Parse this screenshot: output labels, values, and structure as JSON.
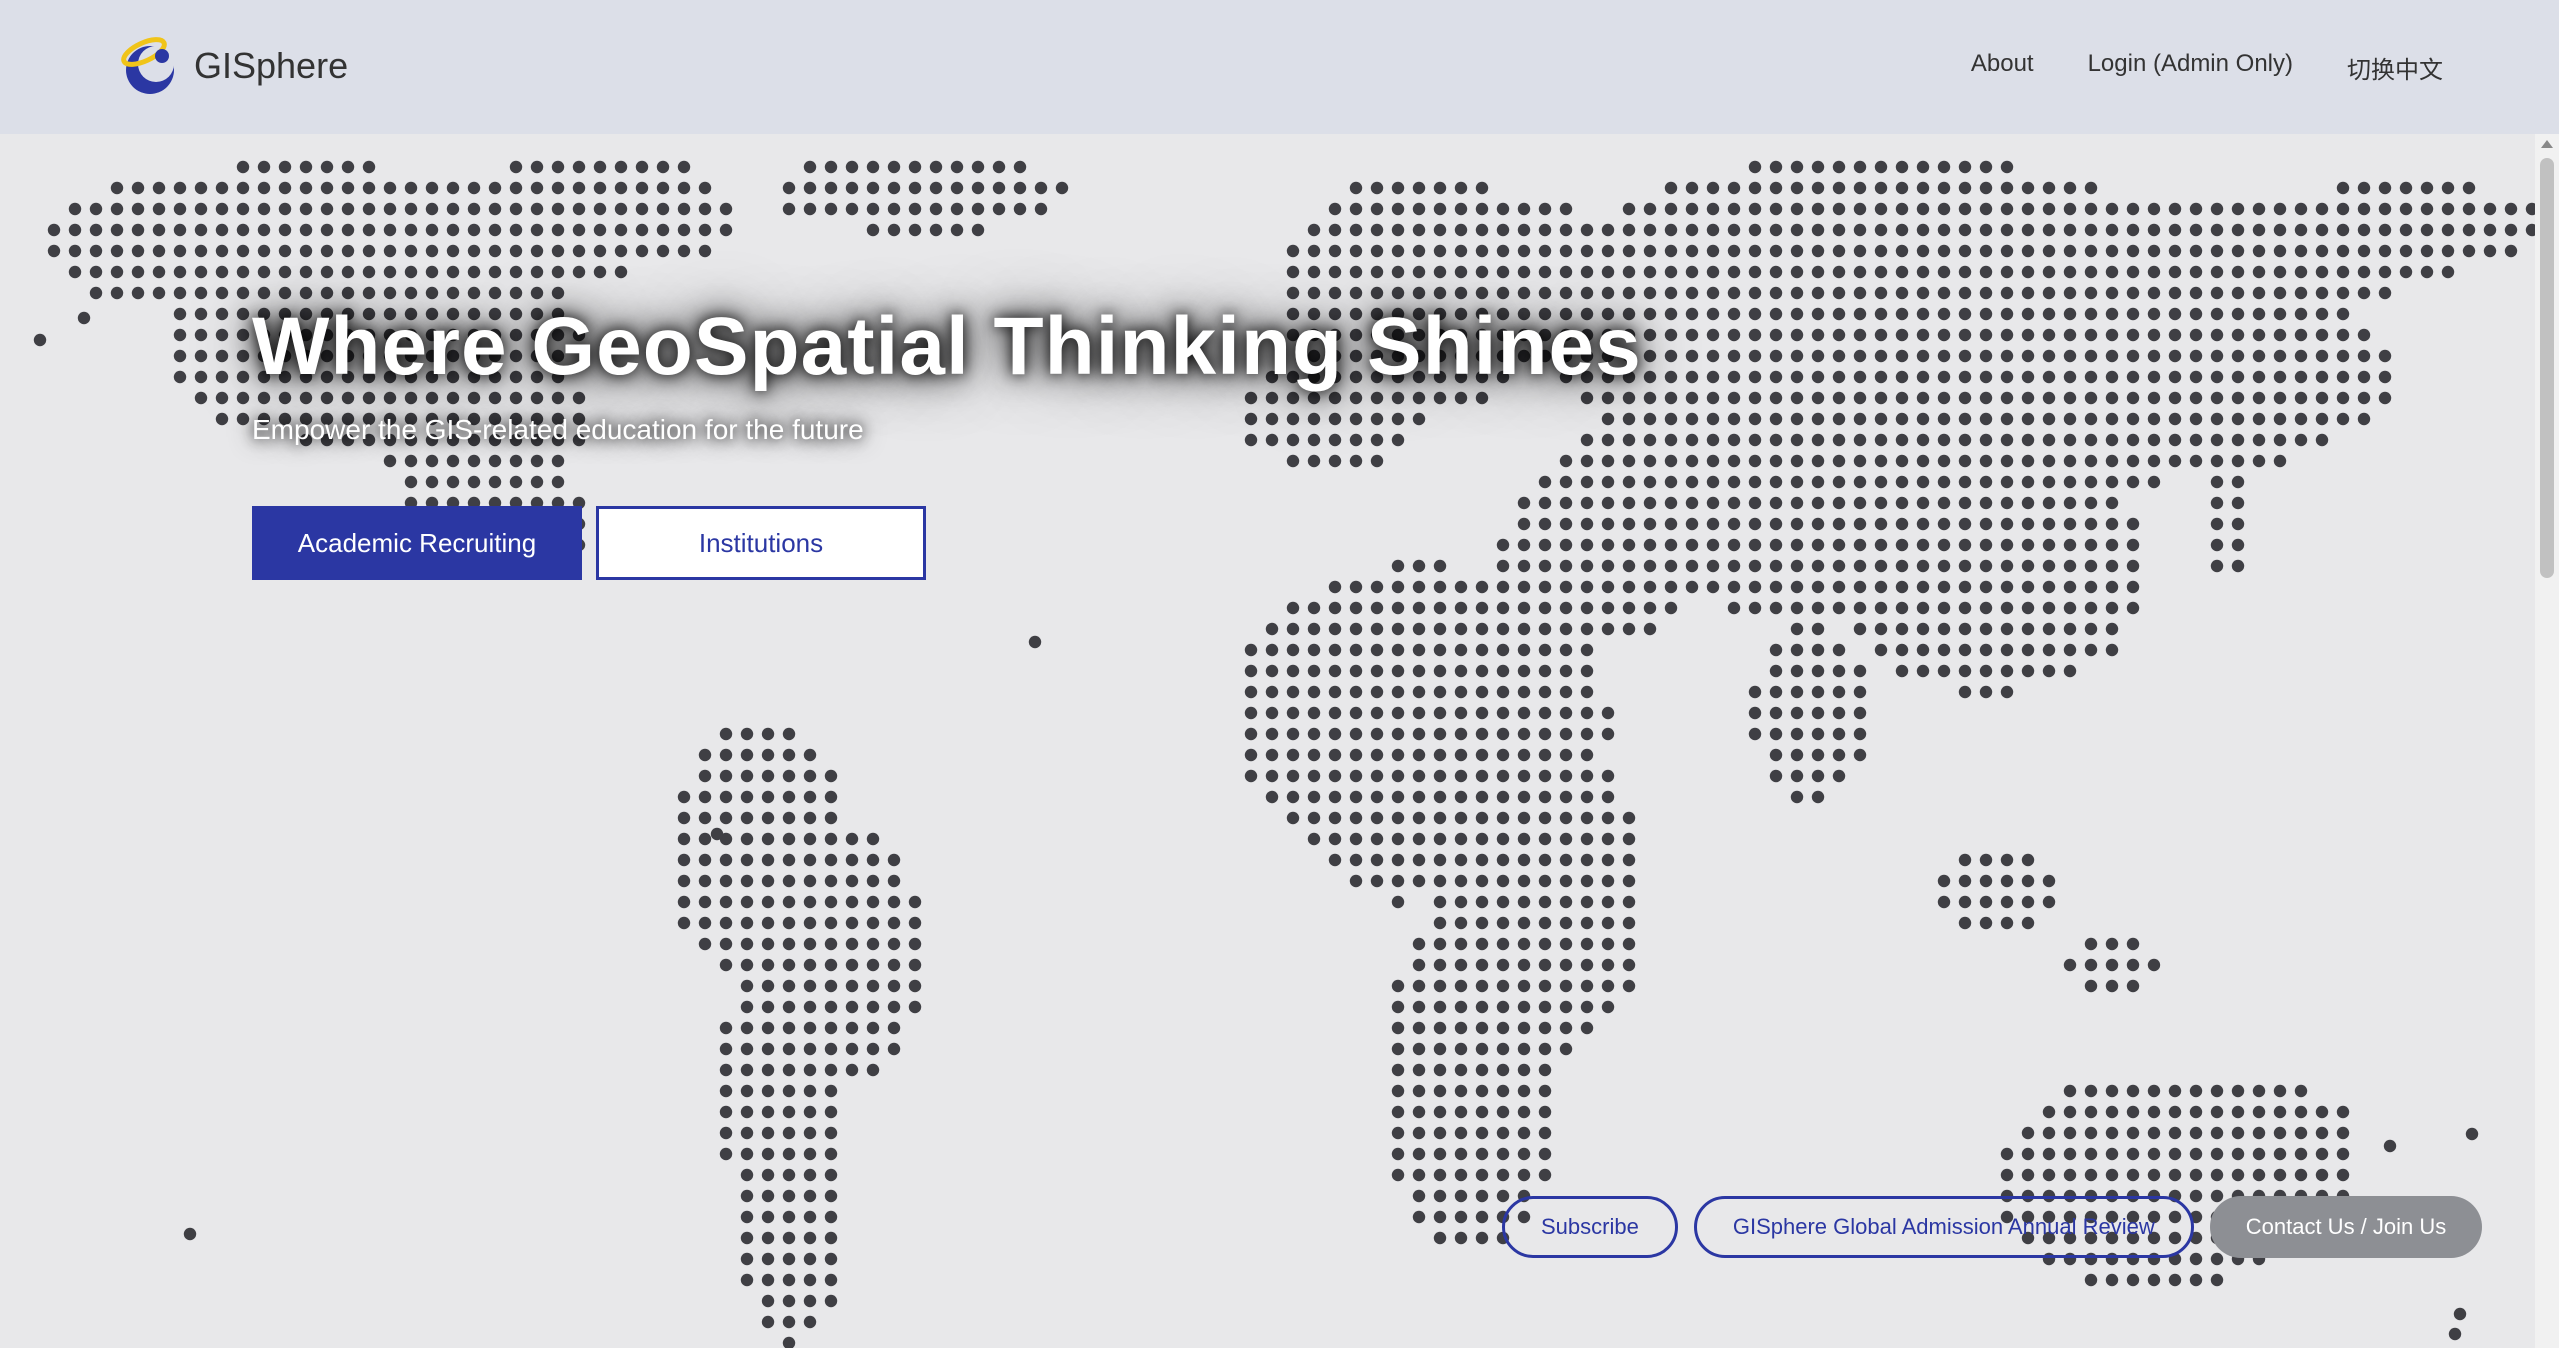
{
  "header": {
    "brand": "GISphere",
    "nav": [
      {
        "label": "About"
      },
      {
        "label": "Login (Admin Only)"
      },
      {
        "label": "切换中文"
      }
    ]
  },
  "hero": {
    "title": "Where GeoSpatial Thinking Shines",
    "subtitle": "Empower the GIS-related education for the future",
    "primary_button": "Academic Recruiting",
    "secondary_button": "Institutions"
  },
  "footer_buttons": {
    "subscribe": "Subscribe",
    "annual_review": "GISphere Global Admission Annual Review",
    "contact": "Contact Us / Join Us"
  },
  "colors": {
    "accent": "#2b37a3",
    "dot": "#3f3f44",
    "header_bg": "#dcdfe8",
    "page_bg": "#e8e8ea"
  }
}
